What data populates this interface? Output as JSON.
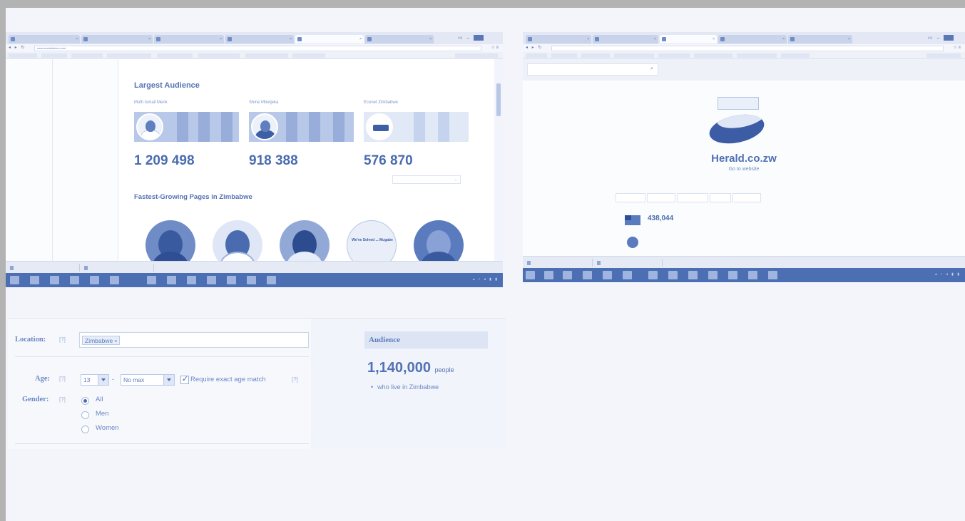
{
  "window1": {
    "tabs": [
      "",
      "",
      "",
      "",
      "",
      ""
    ],
    "url": "www.socialbakers.com",
    "sidebar_items": [
      {
        "label": "",
        "count": ""
      },
      {
        "label": "",
        "count": ""
      },
      {
        "label": "",
        "count": ""
      }
    ],
    "largest_audience_title": "Largest Audience",
    "cards": [
      {
        "name": "Mufti Ismail Menk",
        "fans_label": "",
        "fans": "1 209 498"
      },
      {
        "name": "Shine Mbetjeka",
        "fans_label": "",
        "fans": "918 388"
      },
      {
        "name": "Econet Zimbabwe",
        "fans_label": "",
        "fans": "576 870"
      }
    ],
    "fastest_growing_title": "Fastest-Growing Pages in Zimbabwe",
    "dropdown_label": "",
    "poster_text": "We've Solved ... Mugabe",
    "downloads": [
      "",
      ""
    ],
    "show_all": ""
  },
  "window2": {
    "search_value": "",
    "site_title": "Herald.co.zw",
    "goto_link": "Go to website",
    "tagline": "",
    "tabs": [
      "",
      "",
      "",
      "",
      ""
    ],
    "global_rank": "438,044",
    "global_rank_label": "",
    "country_rank": "",
    "country_rank_label": "",
    "metrics": [
      {
        "label": "",
        "value": ""
      },
      {
        "label": "",
        "value": ""
      },
      {
        "label": "",
        "value": ""
      },
      {
        "label": "",
        "value": ""
      }
    ],
    "downloads": [
      "",
      ""
    ],
    "show_all": ""
  },
  "facebook": {
    "location_label": "Location:",
    "help": "[?]",
    "location_token": "Zimbabwe",
    "age_label": "Age:",
    "age_min": "13",
    "age_max": "No max",
    "dash": "-",
    "exact_age_label": "Require exact age match",
    "gender_label": "Gender:",
    "gender_options": [
      "All",
      "Men",
      "Women"
    ],
    "gender_selected": "All",
    "audience_title": "Audience",
    "audience_count": "1,140,000",
    "audience_unit": "people",
    "audience_desc": "who live in Zimbabwe"
  },
  "colors": {
    "tint": "#3f62a8",
    "background": "#b3b3b3",
    "taskbar": "#4c6eb3"
  }
}
